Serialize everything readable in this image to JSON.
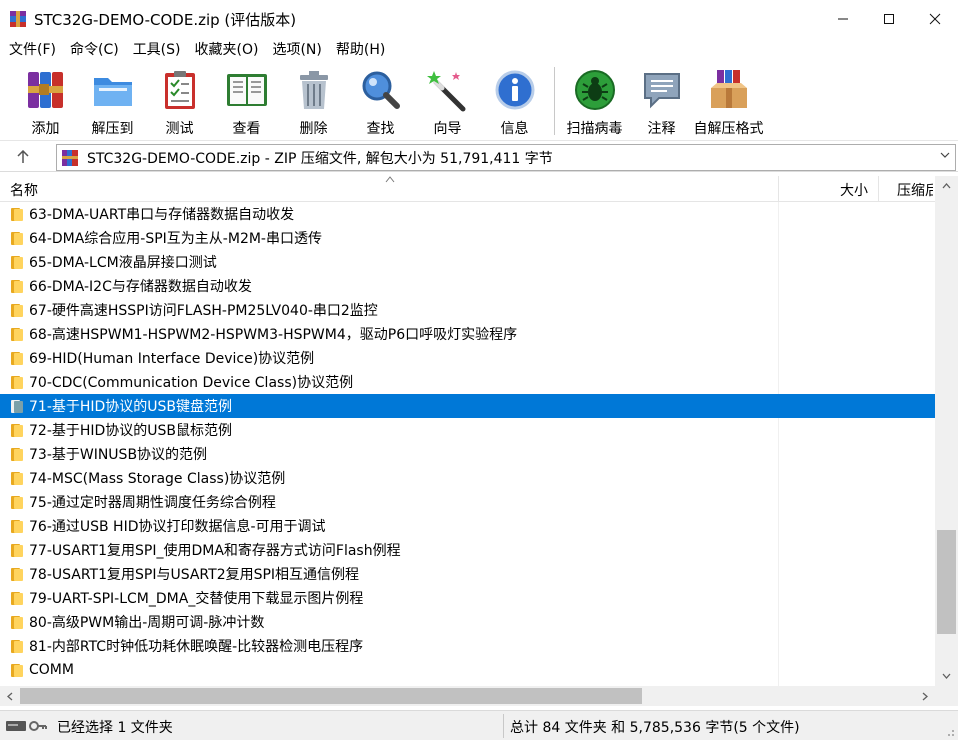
{
  "window": {
    "title": "STC32G-DEMO-CODE.zip (评估版本)",
    "controls": {
      "minimize": "—",
      "maximize": "☐",
      "close": "✕"
    }
  },
  "menu": [
    "文件(F)",
    "命令(C)",
    "工具(S)",
    "收藏夹(O)",
    "选项(N)",
    "帮助(H)"
  ],
  "toolbar": {
    "buttons": [
      {
        "label": "添加",
        "icon": "add-archive-icon"
      },
      {
        "label": "解压到",
        "icon": "extract-folder-icon"
      },
      {
        "label": "测试",
        "icon": "test-clipboard-icon"
      },
      {
        "label": "查看",
        "icon": "view-book-icon"
      },
      {
        "label": "删除",
        "icon": "trash-icon"
      },
      {
        "label": "查找",
        "icon": "magnifier-icon"
      },
      {
        "label": "向导",
        "icon": "wizard-wand-icon"
      },
      {
        "label": "信息",
        "icon": "info-icon"
      },
      {
        "label": "扫描病毒",
        "icon": "virus-scan-icon"
      },
      {
        "label": "注释",
        "icon": "comment-icon"
      },
      {
        "label": "自解压格式",
        "icon": "sfx-box-icon"
      }
    ]
  },
  "address": {
    "up_icon": "↑",
    "text": "STC32G-DEMO-CODE.zip - ZIP 压缩文件, 解包大小为 51,791,411 字节",
    "dropdown": "⌵"
  },
  "columns": {
    "name": "名称",
    "size": "大小",
    "packed": "压缩后大小",
    "sort_indicator": "⌃"
  },
  "files": [
    {
      "name": "63-DMA-UART串口与存储器数据自动收发",
      "selected": false
    },
    {
      "name": "64-DMA综合应用-SPI互为主从-M2M-串口透传",
      "selected": false
    },
    {
      "name": "65-DMA-LCM液晶屏接口测试",
      "selected": false
    },
    {
      "name": "66-DMA-I2C与存储器数据自动收发",
      "selected": false
    },
    {
      "name": "67-硬件高速HSSPI访问FLASH-PM25LV040-串口2监控",
      "selected": false
    },
    {
      "name": "68-高速HSPWM1-HSPWM2-HSPWM3-HSPWM4，驱动P6口呼吸灯实验程序",
      "selected": false
    },
    {
      "name": "69-HID(Human Interface Device)协议范例",
      "selected": false
    },
    {
      "name": "70-CDC(Communication Device Class)协议范例",
      "selected": false
    },
    {
      "name": "71-基于HID协议的USB键盘范例",
      "selected": true
    },
    {
      "name": "72-基于HID协议的USB鼠标范例",
      "selected": false
    },
    {
      "name": "73-基于WINUSB协议的范例",
      "selected": false
    },
    {
      "name": "74-MSC(Mass Storage Class)协议范例",
      "selected": false
    },
    {
      "name": "75-通过定时器周期性调度任务综合例程",
      "selected": false
    },
    {
      "name": "76-通过USB HID协议打印数据信息-可用于调试",
      "selected": false
    },
    {
      "name": "77-USART1复用SPI_使用DMA和寄存器方式访问Flash例程",
      "selected": false
    },
    {
      "name": "78-USART1复用SPI与USART2复用SPI相互通信例程",
      "selected": false
    },
    {
      "name": "79-UART-SPI-LCM_DMA_交替使用下载显示图片例程",
      "selected": false
    },
    {
      "name": "80-高级PWM输出-周期可调-脉冲计数",
      "selected": false
    },
    {
      "name": "81-内部RTC时钟低功耗休眠唤醒-比较器检测电压程序",
      "selected": false
    },
    {
      "name": "COMM",
      "selected": false
    }
  ],
  "scroll": {
    "vertical_position": 0.69,
    "horizontal_position": 0
  },
  "status": {
    "left": "已经选择 1 文件夹",
    "right": "总计 84 文件夹 和 5,785,536 字节(5 个文件)"
  },
  "colors": {
    "selection": "#0078d7",
    "folder": "#ffd45e"
  }
}
